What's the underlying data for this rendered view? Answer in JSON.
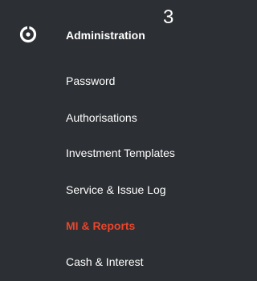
{
  "badge": "3",
  "section": {
    "title": "Administration",
    "icon": "admin-circle-icon"
  },
  "nav": {
    "items": [
      {
        "label": "Password"
      },
      {
        "label": "Authorisations"
      },
      {
        "label": "Investment Templates"
      },
      {
        "label": "Service & Issue Log"
      },
      {
        "label": "MI & Reports",
        "active": true
      },
      {
        "label": "Cash & Interest"
      }
    ]
  },
  "colors": {
    "background": "#2c2f33",
    "text": "#ffffff",
    "active": "#e8452c"
  }
}
